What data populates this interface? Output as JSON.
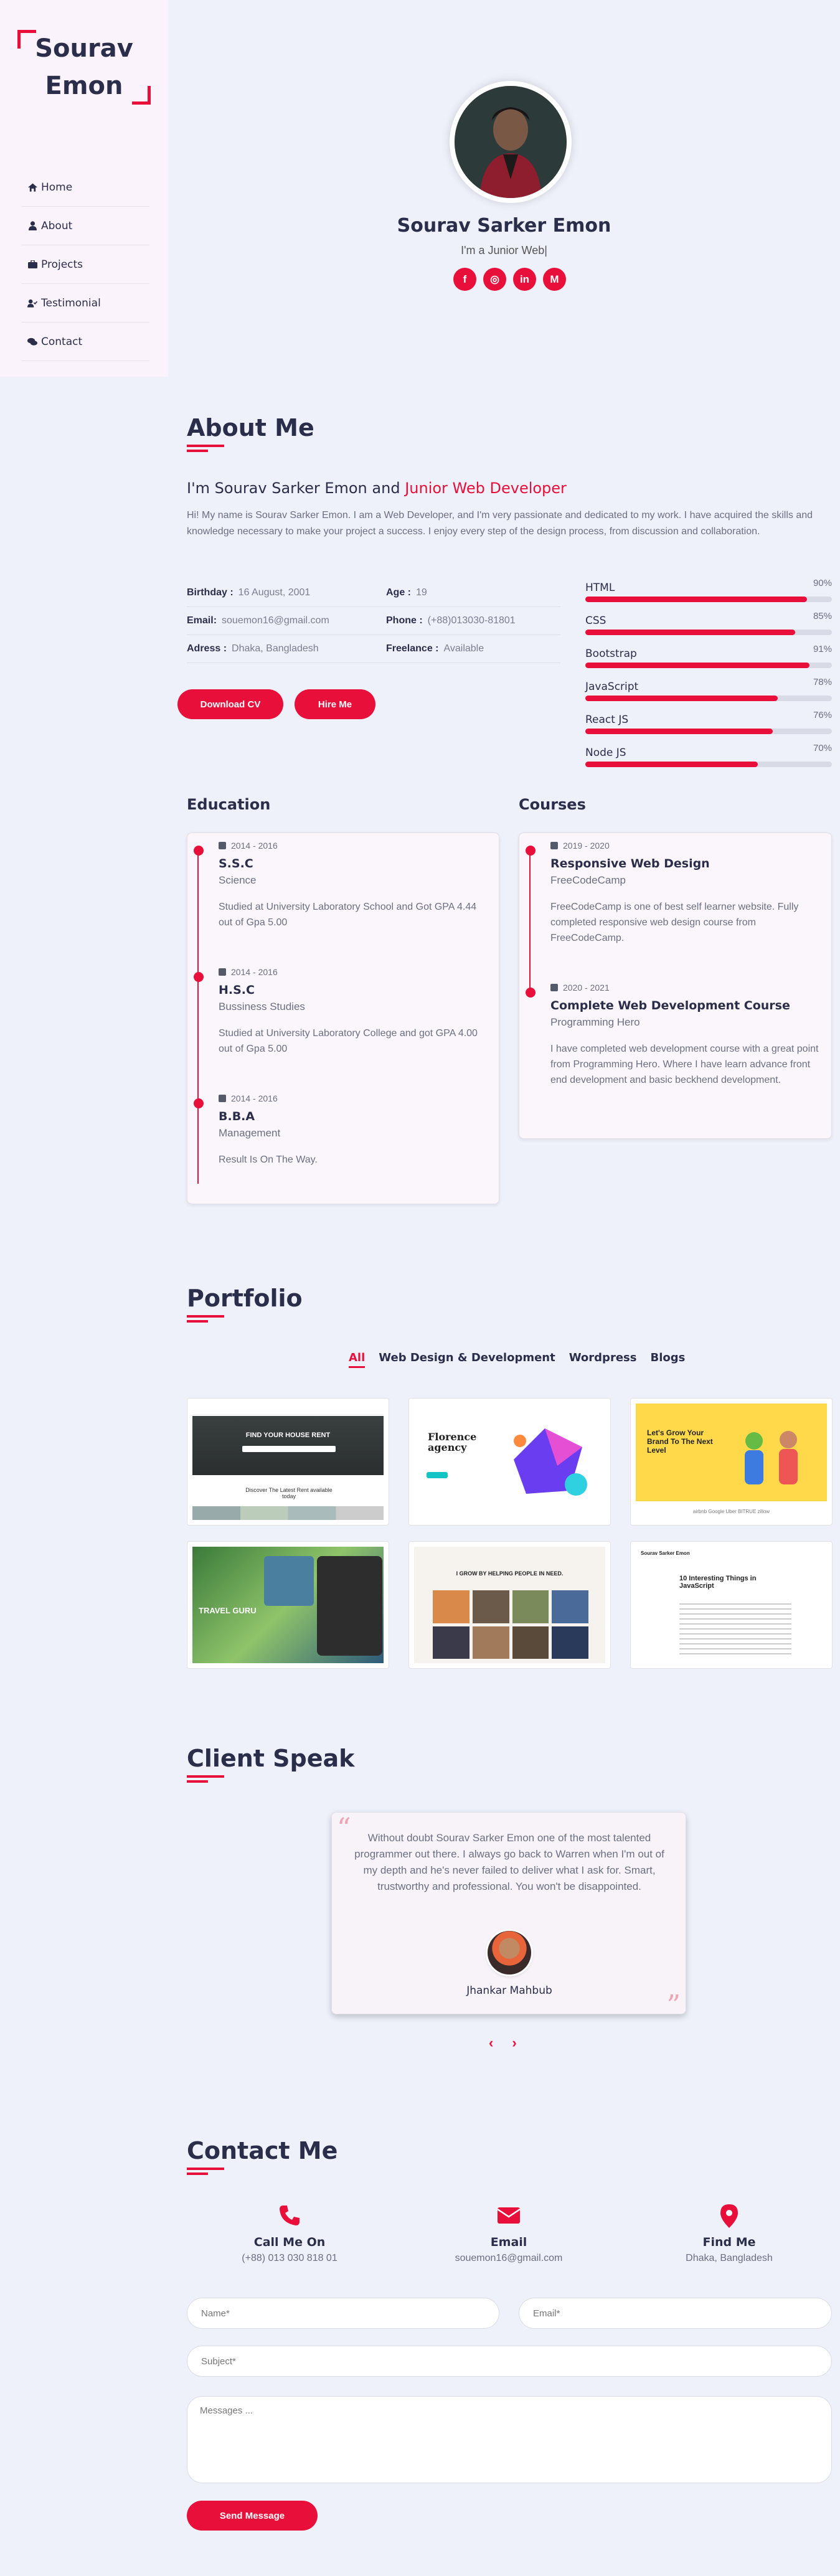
{
  "sidebar": {
    "logo_line1": "Sourav",
    "logo_line2": "Emon",
    "nav": [
      {
        "label": "Home",
        "icon": "home-icon"
      },
      {
        "label": "About",
        "icon": "user-icon"
      },
      {
        "label": "Projects",
        "icon": "briefcase-icon"
      },
      {
        "label": "Testimonial",
        "icon": "user-check-icon"
      },
      {
        "label": "Contact",
        "icon": "comments-icon"
      }
    ]
  },
  "hero": {
    "name": "Sourav Sarker Emon",
    "subtitle": "I'm a Junior Web|",
    "social": [
      "f",
      "◎",
      "in",
      "M"
    ]
  },
  "about": {
    "title": "About Me",
    "heading_prefix": "I'm Sourav Sarker Emon and ",
    "heading_highlight": "Junior Web Developer",
    "paragraph": "Hi! My name is Sourav Sarker Emon. I am a Web Developer, and I'm very passionate and dedicated to my work. I have acquired the skills and knowledge necessary to make your project a success. I enjoy every step of the design process, from discussion and collaboration.",
    "info": [
      {
        "k1": "Birthday :",
        "v1": "16 August, 2001",
        "k2": "Age :",
        "v2": "19"
      },
      {
        "k1": "Email:",
        "v1": "souemon16@gmail.com",
        "k2": "Phone :",
        "v2": "(+88)013030-81801"
      },
      {
        "k1": "Adress :",
        "v1": "Dhaka, Bangladesh",
        "k2": "Freelance :",
        "v2": "Available"
      }
    ],
    "download_cv": "Download CV",
    "hire_me": "Hire Me",
    "skills": [
      {
        "name": "HTML",
        "percent_label": "90%",
        "value": 0.9
      },
      {
        "name": "CSS",
        "percent_label": "85%",
        "value": 0.85
      },
      {
        "name": "Bootstrap",
        "percent_label": "91%",
        "value": 0.91
      },
      {
        "name": "JavaScript",
        "percent_label": "78%",
        "value": 0.78
      },
      {
        "name": "React JS",
        "percent_label": "76%",
        "value": 0.76
      },
      {
        "name": "Node JS",
        "percent_label": "70%",
        "value": 0.7
      }
    ]
  },
  "education": {
    "title": "Education",
    "items": [
      {
        "date": "2014 - 2016",
        "title": "S.S.C",
        "org": "Science",
        "desc": "Studied at University Laboratory School and Got GPA 4.44 out of Gpa 5.00"
      },
      {
        "date": "2014 - 2016",
        "title": "H.S.C",
        "org": "Bussiness Studies",
        "desc": "Studied at University Laboratory College and got GPA 4.00 out of Gpa 5.00"
      },
      {
        "date": "2014 - 2016",
        "title": "B.B.A",
        "org": "Management",
        "desc": "Result Is On The Way."
      }
    ]
  },
  "courses": {
    "title": "Courses",
    "items": [
      {
        "date": "2019 - 2020",
        "title": "Responsive Web Design",
        "org": "FreeCodeCamp",
        "desc": "FreeCodeCamp is one of best self learner website. Fully completed responsive web design course from FreeCodeCamp."
      },
      {
        "date": "2020 - 2021",
        "title": "Complete Web Development Course",
        "org": "Programming Hero",
        "desc": "I have completed web development course with a great point from Programming Hero. Where I have learn advance front end development and basic beckhend development."
      }
    ]
  },
  "portfolio": {
    "title": "Portfolio",
    "filters": [
      "All",
      "Web Design & Development",
      "Wordpress",
      "Blogs"
    ],
    "thumbs": {
      "p1": "FIND YOUR HOUSE RENT",
      "p1b": "Discover The Latest Rent available today",
      "p2": "Florence agency",
      "p3": "Let's Grow Your Brand To The Next Level",
      "p3b": "airbnb  Google  Uber  BITRUE  zillow",
      "p4": "TRAVEL GURU",
      "p5": "I GROW BY HELPING PEOPLE IN NEED.",
      "p6": "10 Interesting Things in JavaScript",
      "p6b": "Sourav Sarker Emon"
    }
  },
  "testimonial": {
    "title": "Client Speak",
    "text": "Without doubt Sourav Sarker Emon one of the most talented programmer out there. I always go back to Warren when I'm out of my depth and he's never failed to deliver what I ask for. Smart, trustworthy and professional. You won't be disappointed.",
    "name": "Jhankar Mahbub",
    "prev": "‹",
    "next": "›"
  },
  "contact": {
    "title": "Contact Me",
    "cards": [
      {
        "title": "Call Me On",
        "value": "(+88) 013 030 818 01",
        "icon": "phone-icon"
      },
      {
        "title": "Email",
        "value": "souemon16@gmail.com",
        "icon": "envelope-icon"
      },
      {
        "title": "Find Me",
        "value": "Dhaka, Bangladesh",
        "icon": "map-marker-icon"
      }
    ],
    "name_placeholder": "Name*",
    "email_placeholder": "Email*",
    "subject_placeholder": "Subject*",
    "message_placeholder": "Messages ...",
    "send": "Send Message"
  },
  "colors": {
    "accent": "#e8103b",
    "dark": "#2b2e4a",
    "page_bg": "#eef0fa",
    "sidebar_bg": "#fbf3fb"
  }
}
